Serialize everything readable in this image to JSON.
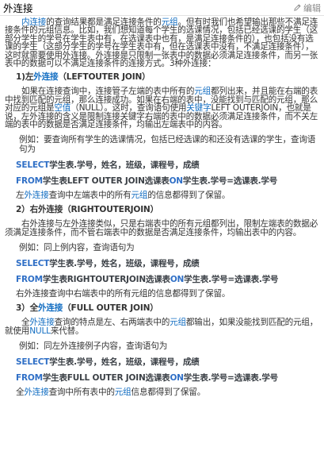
{
  "header": {
    "title": "外连接",
    "edit_label": "编辑"
  },
  "intro": {
    "t1": "内连接",
    "t2": "的查询结果都是满足连接条件的",
    "t3": "元组",
    "t4": "。但有时我们也希望输出那些不满足连接条件的元组信息。比如，我们想知道每个学生的选课情况，包括已经选课的学生（这部分学生的学号在学生表中有，在选课表中也有，是满足连接条件的），也包括没有选课的学生（这部分学生的学号在学生表中有，但在选课表中没有，不满足连接条件），这时就需要使用外连接。外连接是只限制一张表中的数据必须满足连接条件，而另一张表中的数据可以不满足连接条件的连接方式。3种外连接："
  },
  "left": {
    "h_pre": "1)左",
    "h_link": "外连接",
    "h_post": "（LEFTOUTER JOIN）",
    "d1": "如果在连接查询中，连接管子左端的表中所有的",
    "d2": "元组",
    "d3": "都列出来，并且能在右端的表中找到匹配的元组，那么连接成功。如果在右端的表中，没能找到与匹配的元组，那么对应的元组是",
    "d4": "空值",
    "d5": "（NULL）。这时，查询语句使用",
    "d6": "关键字",
    "d7": "LEFT OUTERJOIN，也就是说，左外连接的含义是限制连接关键字右端的表中的数据必须满足连接条件，而不关左端的表中的数据是否满足连接条件，均输出左端表中的内容。",
    "ex": "例如：要查询所有学生的选课情况，包括已经选课的和还没有选课的学生，查询语句为",
    "c1a": "SELECT",
    "c1b": "学生表.学号，姓名，班级，课程号，成绩",
    "c2a": "FROM",
    "c2b": "学生表LEFT OUTER JOIN选课表",
    "c2c": "ON",
    "c2d": "学生表.学号=选课表.学号",
    "r1": "左",
    "r2": "外连接",
    "r3": "查询中左端表中的所有",
    "r4": "元组",
    "r5": "的信息都得到了保留。"
  },
  "right": {
    "h": "2）右外连接（RIGHTOUTERJOIN）",
    "d": "右外连接与左外连接类似，只是右端表中的所有元组都列出，限制左端表的数据必须满足连接条件，而不管右端表中的数据是否满足连接条件，均输出表中的内容。",
    "ex": "例如：同上例内容，查询语句为",
    "c1a": "SELECT",
    "c1b": "学生表.学号，姓名，班级，课程号，成绩",
    "c2a": "FROM",
    "c2b": "学生表RIGHTOUTERJOIN选课表",
    "c2c": "ON",
    "c2d": "学生表.学号=选课表.学号",
    "r": "右外连接查询中右端表中的所有元组的信息都得到了保留。"
  },
  "full": {
    "h_pre": "3）全",
    "h_link": "外连接",
    "h_post": "（FULL OUTER JOIN）",
    "d1": "全",
    "d2": "外连接",
    "d3": "查询的特点是左、右两端表中的",
    "d4": "元组",
    "d5": "都输出，如果没能找到匹配的元组，就使用",
    "d6": "NULL",
    "d7": "来代替。",
    "ex": "例如：同左外连接例子内容，查询语句为",
    "c1a": "SELECT",
    "c1b": "学生表.学号，姓名，班级，课程号，成绩",
    "c2a": "FROM",
    "c2b": "学生表FULL OUTER JOIN选课表",
    "c2c": "ON",
    "c2d": "学生表.学号=选课表.学号",
    "r1": "全",
    "r2": "外连接",
    "r3": "查询中所有表中的",
    "r4": "元组",
    "r5": "信息都得到了保留。"
  }
}
